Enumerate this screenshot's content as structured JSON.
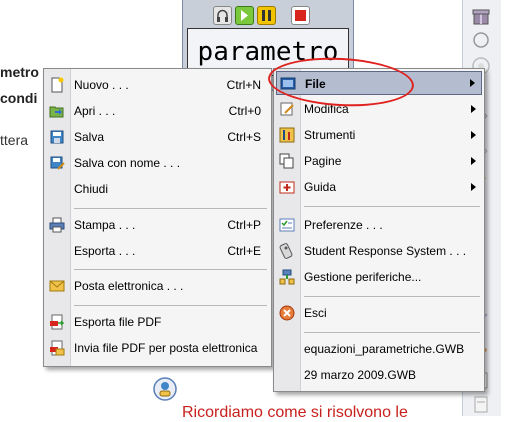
{
  "background": {
    "text_lines": [
      "metro",
      "condi",
      "ttera"
    ],
    "bottom_caption": "Ricordiamo come si risolvono le",
    "widget_title": "parametro"
  },
  "file_menu": {
    "items": [
      {
        "label": "Nuovo . . .",
        "shortcut": "Ctrl+N",
        "icon": "new-document-icon"
      },
      {
        "label": "Apri . . .",
        "shortcut": "Ctrl+0",
        "icon": "open-folder-icon"
      },
      {
        "label": "Salva",
        "shortcut": "Ctrl+S",
        "icon": "save-icon"
      },
      {
        "label": "Salva con nome . . .",
        "shortcut": "",
        "icon": "save-as-icon"
      },
      {
        "label": "Chiudi",
        "shortcut": "",
        "icon": ""
      },
      {
        "label": "Stampa . . .",
        "shortcut": "Ctrl+P",
        "icon": "print-icon"
      },
      {
        "label": "Esporta . . .",
        "shortcut": "Ctrl+E",
        "icon": ""
      },
      {
        "label": "Posta elettronica . . .",
        "shortcut": "",
        "icon": "email-icon"
      },
      {
        "label": "Esporta file PDF",
        "shortcut": "",
        "icon": "export-pdf-icon"
      },
      {
        "label": "Invia file PDF per posta elettronica",
        "shortcut": "",
        "icon": "send-pdf-icon"
      }
    ]
  },
  "main_menu": {
    "items": [
      {
        "label": "File",
        "selected": true,
        "icon": "file-folder-icon",
        "submenu": true
      },
      {
        "label": "Modifica",
        "icon": "edit-icon",
        "submenu": true
      },
      {
        "label": "Strumenti",
        "icon": "tools-icon",
        "submenu": true
      },
      {
        "label": "Pagine",
        "icon": "pages-icon",
        "submenu": true
      },
      {
        "label": "Guida",
        "icon": "help-icon",
        "submenu": true
      },
      {
        "label": "Preferenze . . .",
        "icon": "preferences-icon"
      },
      {
        "label": "Student Response System . . .",
        "icon": "response-system-icon"
      },
      {
        "label": "Gestione periferiche...",
        "icon": "devices-icon"
      },
      {
        "label": "Esci",
        "icon": "exit-icon"
      },
      {
        "label": "equazioni_parametriche.GWB",
        "icon": ""
      },
      {
        "label": "29 marzo 2009.GWB",
        "icon": ""
      }
    ]
  },
  "colors": {
    "highlight": "#b4bdd0",
    "annotation_red": "#e0221f",
    "caption_red": "#c8201c"
  }
}
